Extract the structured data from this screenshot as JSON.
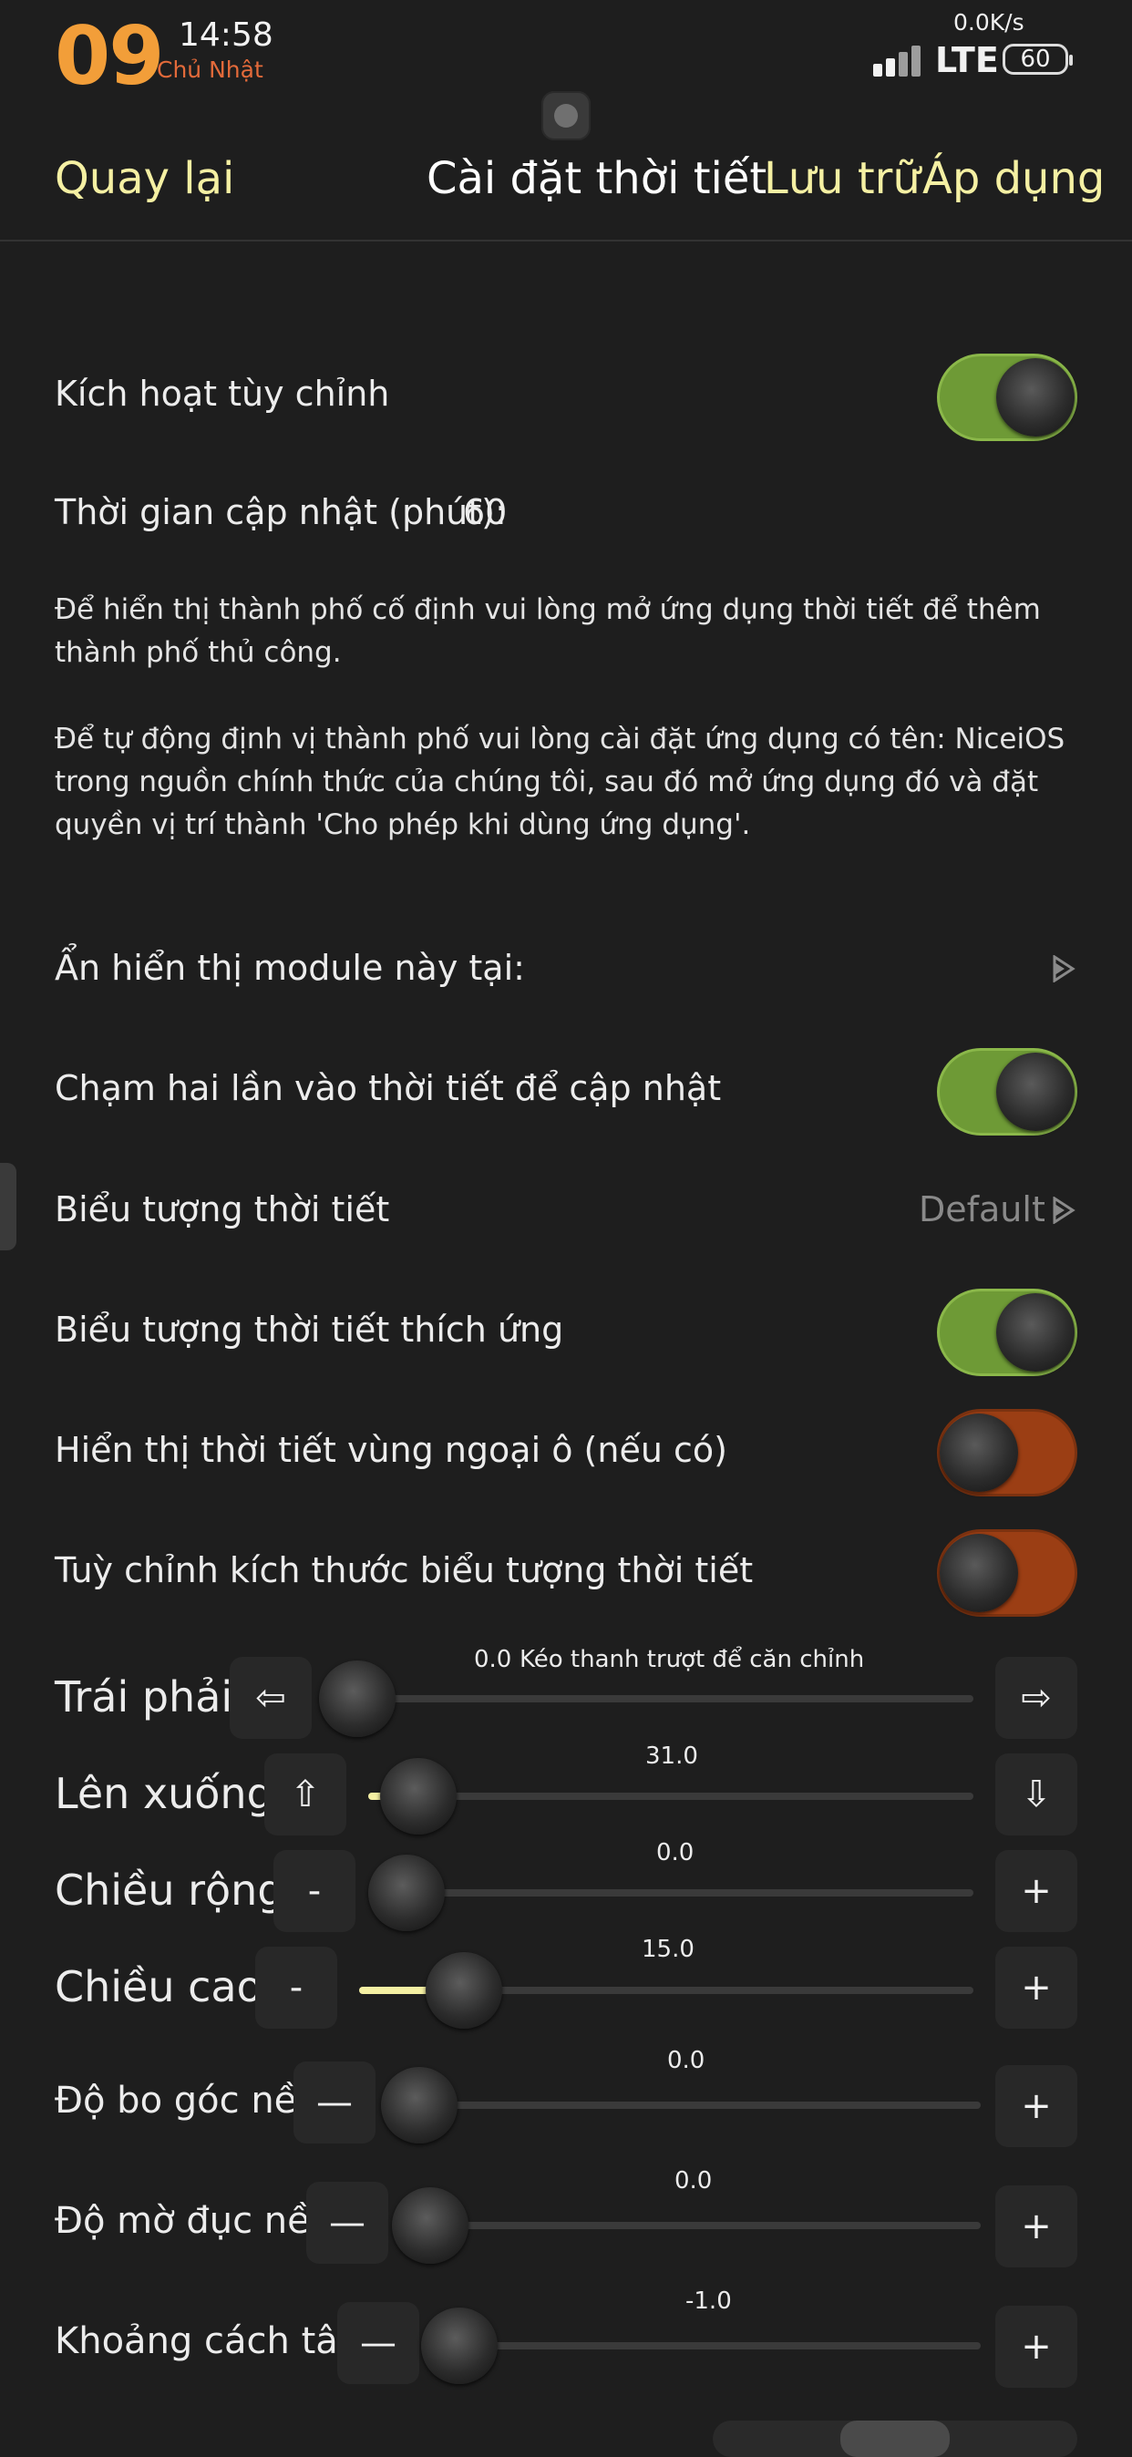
{
  "status_bar": {
    "hour_big": "09",
    "clock": "14:58",
    "weekday": "Chủ Nhật",
    "net_speed": "0.0K/s",
    "network": "LTE",
    "battery": "60"
  },
  "nav": {
    "back": "Quay lại",
    "title": "Cài đặt thời tiết",
    "save": "Lưu trữ",
    "apply": "Áp dụng"
  },
  "settings": {
    "enable_custom": {
      "label": "Kích hoạt tùy chỉnh",
      "on": true
    },
    "update_interval": {
      "label": "Thời gian cập nhật (phút):",
      "value": "60"
    },
    "info_fixed_city": "Để hiển thị thành phố cố định vui lòng mở ứng dụng thời tiết để thêm thành phố thủ công.",
    "info_auto_locate": "Để tự động định vị thành phố vui lòng cài đặt ứng dụng có tên: NiceiOS trong nguồn chính thức của chúng tôi, sau đó mở ứng dụng đó và đặt quyền vị trí thành 'Cho phép khi dùng ứng dụng'.",
    "hide_module": {
      "label": "Ẩn hiển thị module này tại:"
    },
    "double_tap_update": {
      "label": "Chạm hai lần vào thời tiết để cập nhật",
      "on": true
    },
    "weather_icon": {
      "label": "Biểu tượng thời tiết",
      "value": "Default"
    },
    "adaptive_icon": {
      "label": "Biểu tượng thời tiết thích ứng",
      "on": true
    },
    "suburb_weather": {
      "label": "Hiển thị thời tiết vùng ngoại ô (nếu có)",
      "on": false
    },
    "custom_icon_size": {
      "label": "Tuỳ chỉnh kích thước biểu tượng thời tiết",
      "on": false
    }
  },
  "sliders": {
    "left_right": {
      "label": "Trái phải",
      "value": "0.0",
      "hint": "Kéo thanh trượt để căn chỉnh",
      "dec": "⇦",
      "inc": "⇨",
      "fraction": 0.0
    },
    "up_down": {
      "label": "Lên xuống",
      "value": "31.0",
      "dec": "⇧",
      "inc": "⇩",
      "fraction": 0.04
    },
    "width": {
      "label": "Chiều rộng",
      "value": "0.0",
      "dec": "-",
      "inc": "+",
      "fraction": 0.0
    },
    "height": {
      "label": "Chiều cao",
      "value": "15.0",
      "dec": "-",
      "inc": "+",
      "fraction": 0.14
    },
    "corner_radius": {
      "label": "Độ bo góc nền",
      "value": "0.0",
      "dec": "—",
      "inc": "+",
      "fraction": 0.0
    },
    "bg_opacity": {
      "label": "Độ mờ đục nền",
      "value": "0.0",
      "dec": "—",
      "inc": "+",
      "fraction": 0.0
    },
    "center_spacing": {
      "label": "Khoảng cách tâm",
      "value": "-1.0",
      "dec": "—",
      "inc": "+",
      "fraction": 0.0
    }
  },
  "colors": {
    "accent": "#f5f0a3",
    "toggle_on": "#6e9a36",
    "toggle_off": "#9b3e14",
    "clock_accent": "#f29e39",
    "background": "#1e1e1e"
  }
}
